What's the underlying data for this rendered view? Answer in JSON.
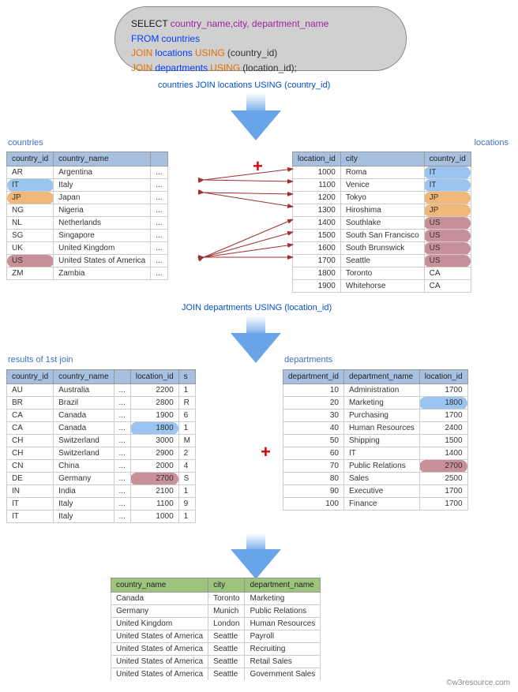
{
  "sql": {
    "select": "SELECT",
    "cols": "country_name,city, department_name",
    "from": "FROM",
    "t_countries": "countries",
    "join1": "JOIN",
    "t_locations": "locations",
    "using1": "USING",
    "arg1": "(country_id)",
    "join2": "JOIN",
    "t_departments": "departments",
    "using2": "USING",
    "arg2": "(location_id);"
  },
  "labels": {
    "joinlbl1": "countries JOIN locations USING (country_id)",
    "joinlbl2": "JOIN departments USING (location_id)",
    "countries": "countries",
    "locations": "locations",
    "results1": "results of 1st join",
    "departments": "departments"
  },
  "countries": {
    "headers": [
      "country_id",
      "country_name",
      ""
    ],
    "rows": [
      {
        "id": "AR",
        "name": "Argentina",
        "x": "..."
      },
      {
        "id": "IT",
        "name": "Italy",
        "x": "...",
        "hl": "blue"
      },
      {
        "id": "JP",
        "name": "Japan",
        "x": "...",
        "hl": "orange"
      },
      {
        "id": "NG",
        "name": "Nigeria",
        "x": "..."
      },
      {
        "id": "NL",
        "name": "Netherlands",
        "x": "..."
      },
      {
        "id": "SG",
        "name": "Singapore",
        "x": "..."
      },
      {
        "id": "UK",
        "name": "United Kingdom",
        "x": "..."
      },
      {
        "id": "US",
        "name": "United States of America",
        "x": "...",
        "hl": "mauve"
      },
      {
        "id": "ZM",
        "name": "Zambia",
        "x": "..."
      }
    ]
  },
  "locations": {
    "headers": [
      "location_id",
      "city",
      "country_id"
    ],
    "rows": [
      {
        "loc": "1000",
        "city": "Roma",
        "cid": "IT",
        "hl": "blue"
      },
      {
        "loc": "1100",
        "city": "Venice",
        "cid": "IT",
        "hl": "blue"
      },
      {
        "loc": "1200",
        "city": "Tokyo",
        "cid": "JP",
        "hl": "orange"
      },
      {
        "loc": "1300",
        "city": "Hiroshima",
        "cid": "JP",
        "hl": "orange"
      },
      {
        "loc": "1400",
        "city": "Southlake",
        "cid": "US",
        "hl": "mauve"
      },
      {
        "loc": "1500",
        "city": "South San Francisco",
        "cid": "US",
        "hl": "mauve"
      },
      {
        "loc": "1600",
        "city": "South Brunswick",
        "cid": "US",
        "hl": "mauve"
      },
      {
        "loc": "1700",
        "city": "Seattle",
        "cid": "US",
        "hl": "mauve"
      },
      {
        "loc": "1800",
        "city": "Toronto",
        "cid": "CA"
      },
      {
        "loc": "1900",
        "city": "Whitehorse",
        "cid": "CA"
      }
    ]
  },
  "join1result": {
    "headers": [
      "country_id",
      "country_name",
      "",
      "location_id",
      "s"
    ],
    "rows": [
      {
        "id": "AU",
        "name": "Australia",
        "x": "...",
        "loc": "2200",
        "s": "1"
      },
      {
        "id": "BR",
        "name": "Brazil",
        "x": "...",
        "loc": "2800",
        "s": "R"
      },
      {
        "id": "CA",
        "name": "Canada",
        "x": "...",
        "loc": "1900",
        "s": "6"
      },
      {
        "id": "CA",
        "name": "Canada",
        "x": "...",
        "loc": "1800",
        "s": "1",
        "hl": "blue"
      },
      {
        "id": "CH",
        "name": "Switzerland",
        "x": "...",
        "loc": "3000",
        "s": "M"
      },
      {
        "id": "CH",
        "name": "Switzerland",
        "x": "...",
        "loc": "2900",
        "s": "2"
      },
      {
        "id": "CN",
        "name": "China",
        "x": "...",
        "loc": "2000",
        "s": "4"
      },
      {
        "id": "DE",
        "name": "Germany",
        "x": "...",
        "loc": "2700",
        "s": "S",
        "hl": "mauve"
      },
      {
        "id": "IN",
        "name": "India",
        "x": "...",
        "loc": "2100",
        "s": "1"
      },
      {
        "id": "IT",
        "name": "Italy",
        "x": "...",
        "loc": "1100",
        "s": "9"
      },
      {
        "id": "IT",
        "name": "Italy",
        "x": "...",
        "loc": "1000",
        "s": "1"
      }
    ]
  },
  "departments": {
    "headers": [
      "department_id",
      "department_name",
      "location_id"
    ],
    "rows": [
      {
        "id": "10",
        "name": "Administration",
        "loc": "1700"
      },
      {
        "id": "20",
        "name": "Marketing",
        "loc": "1800",
        "hl": "blue"
      },
      {
        "id": "30",
        "name": "Purchasing",
        "loc": "1700"
      },
      {
        "id": "40",
        "name": "Human Resources",
        "loc": "2400"
      },
      {
        "id": "50",
        "name": "Shipping",
        "loc": "1500"
      },
      {
        "id": "60",
        "name": "IT",
        "loc": "1400"
      },
      {
        "id": "70",
        "name": "Public Relations",
        "loc": "2700",
        "hl": "mauve"
      },
      {
        "id": "80",
        "name": "Sales",
        "loc": "2500"
      },
      {
        "id": "90",
        "name": "Executive",
        "loc": "1700"
      },
      {
        "id": "100",
        "name": "Finance",
        "loc": "1700"
      }
    ]
  },
  "final": {
    "headers": [
      "country_name",
      "city",
      "department_name"
    ],
    "rows": [
      {
        "c": "Canada",
        "city": "Toronto",
        "d": "Marketing"
      },
      {
        "c": "Germany",
        "city": "Munich",
        "d": "Public Relations"
      },
      {
        "c": "United Kingdom",
        "city": "London",
        "d": "Human Resources"
      },
      {
        "c": "United States of America",
        "city": "Seattle",
        "d": "Payroll"
      },
      {
        "c": "United States of America",
        "city": "Seattle",
        "d": "Recruiting"
      },
      {
        "c": "United States of America",
        "city": "Seattle",
        "d": "Retail Sales"
      },
      {
        "c": "United States of America",
        "city": "Seattle",
        "d": "Government Sales"
      }
    ]
  },
  "attribution": "©w3resource.com"
}
